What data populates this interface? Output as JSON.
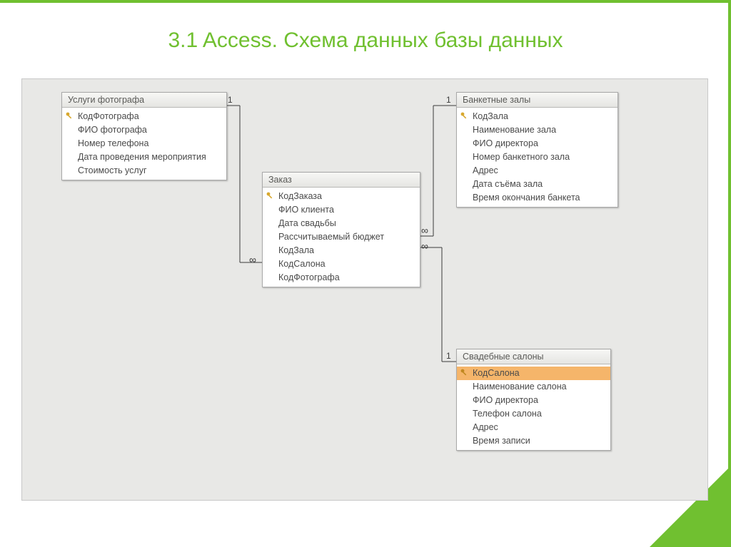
{
  "title": "3.1 Access. Схема данных базы данных",
  "tables": {
    "photo": {
      "title": "Услуги фотографа",
      "fields": [
        "КодФотографа",
        "ФИО фотографа",
        "Номер телефона",
        "Дата проведения мероприятия",
        "Стоимость услуг"
      ]
    },
    "order": {
      "title": "Заказ",
      "fields": [
        "КодЗаказа",
        "ФИО клиента",
        "Дата свадьбы",
        "Рассчитываемый бюджет",
        "КодЗала",
        "КодСалона",
        "КодФотографа"
      ]
    },
    "halls": {
      "title": "Банкетные залы",
      "fields": [
        "КодЗала",
        "Наименование зала",
        "ФИО директора",
        "Номер банкетного зала",
        "Адрес",
        "Дата съёма зала",
        "Время окончания банкета"
      ]
    },
    "salons": {
      "title": "Свадебные салоны",
      "fields": [
        "КодСалона",
        "Наименование салона",
        "ФИО директора",
        "Телефон салона",
        "Адрес",
        "Время записи"
      ]
    }
  },
  "rel_labels": {
    "one": "1",
    "many": "∞"
  }
}
